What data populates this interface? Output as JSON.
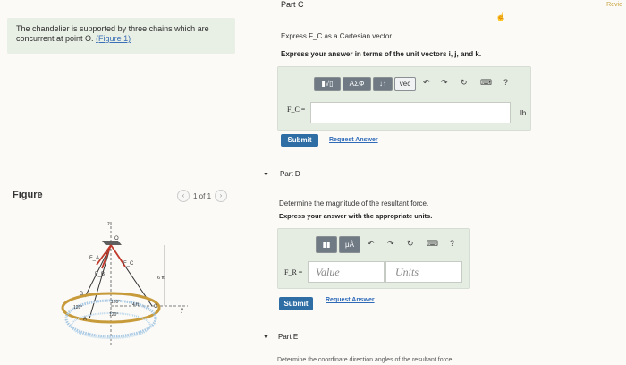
{
  "problem": {
    "text": "The chandelier is supported by three chains which are concurrent at point O.",
    "link": "(Figure 1)"
  },
  "figure": {
    "heading": "Figure",
    "pager": "1 of 1",
    "labels": {
      "z": "z",
      "O": "O",
      "F_A": "F_A",
      "F_C": "F_C",
      "F_B": "F_B",
      "dim": "6 ft",
      "B": "B",
      "A": "A",
      "C": "C",
      "r": "4 ft",
      "a120_1": "120°",
      "a120_2": "120°",
      "a120_3": "120°",
      "y": "y",
      "x": "x"
    }
  },
  "review_link": "Revie",
  "partC": {
    "title": "Part C",
    "instruction": "Express F_C as a Cartesian vector.",
    "instruction_bold": "Express your answer in terms of the unit vectors i, j, and k.",
    "toolbar": {
      "templates": "▮√▯",
      "greek": "ΑΣΦ",
      "arrows": "↓↑",
      "vec": "vec"
    },
    "label": "F_C =",
    "unit": "lb",
    "submit": "Submit",
    "request": "Request Answer"
  },
  "partD": {
    "title": "Part D",
    "instruction": "Determine the magnitude of the resultant force.",
    "instruction_bold": "Express your answer with the appropriate units.",
    "toolbar": {
      "templates": "▮▮",
      "units": "μÅ"
    },
    "label": "F_R =",
    "value_placeholder": "Value",
    "units_placeholder": "Units",
    "submit": "Submit",
    "request": "Request Answer"
  },
  "partE": {
    "title": "Part E",
    "instruction": "Determine the coordinate direction angles of the resultant force"
  }
}
